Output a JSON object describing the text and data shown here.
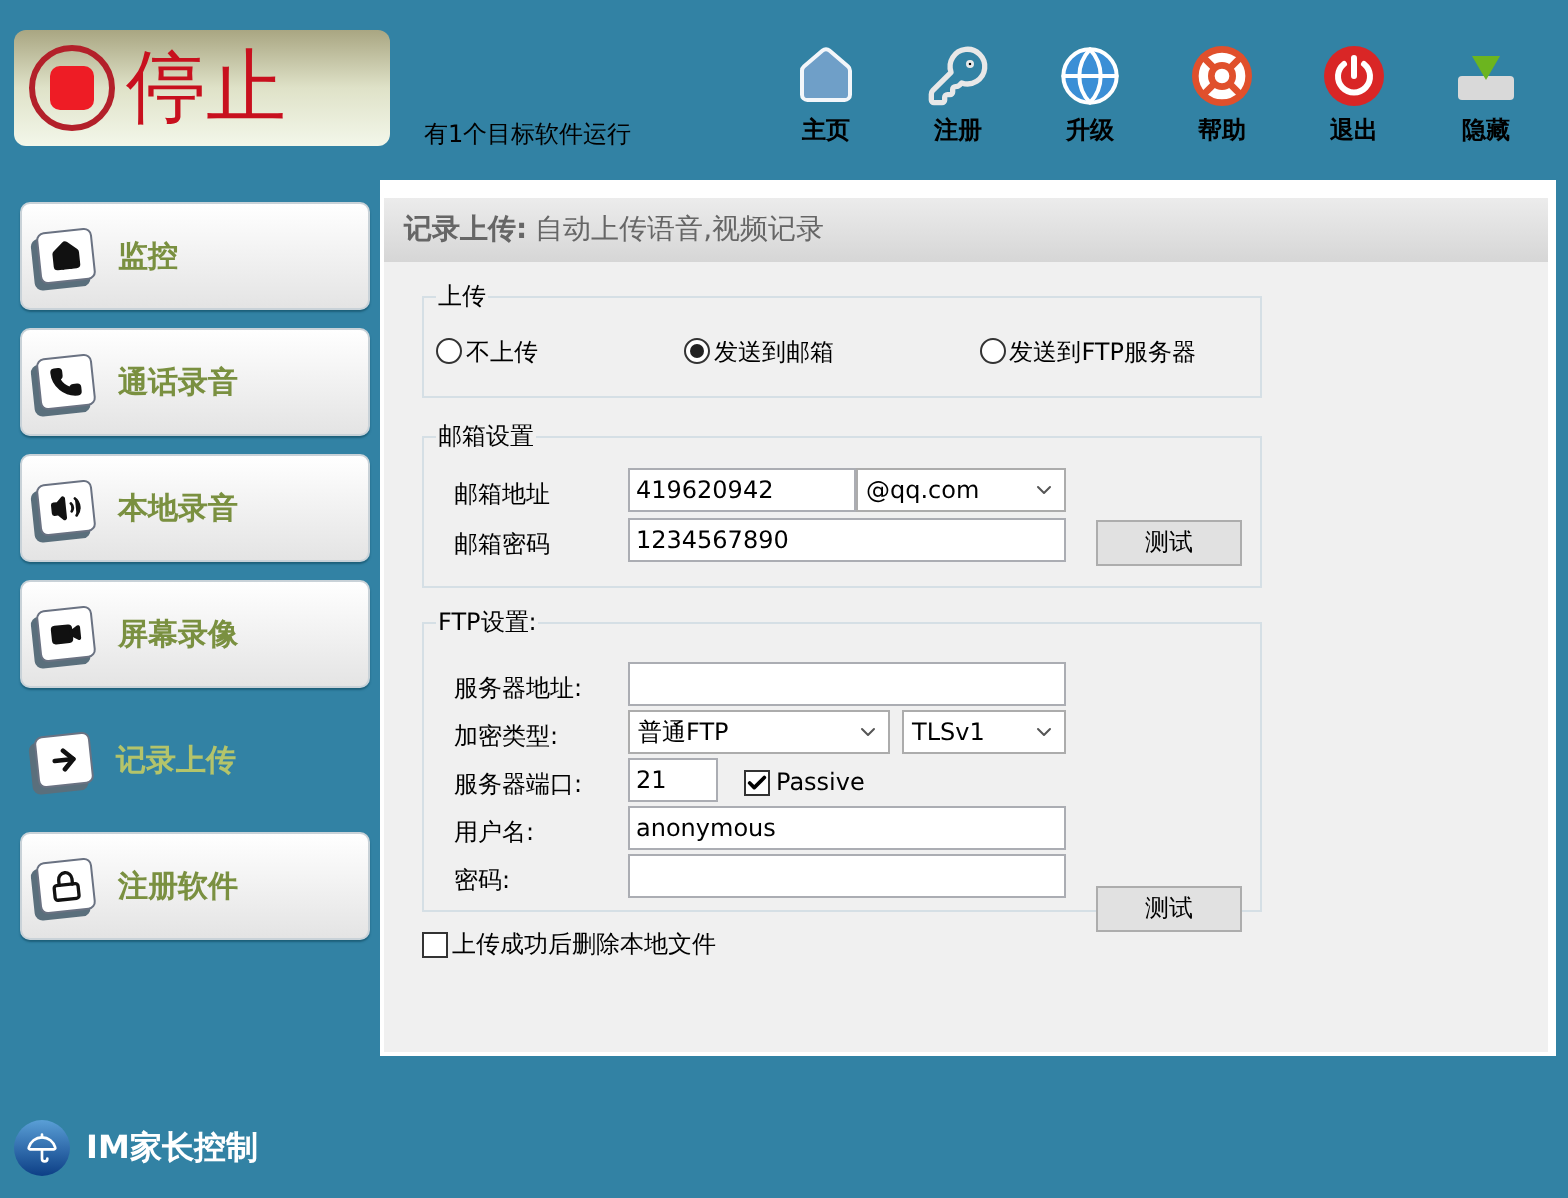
{
  "stop_button": {
    "label": "停止"
  },
  "status_text": "有1个目标软件运行",
  "toolbar": [
    {
      "label": "主页",
      "kind": "home"
    },
    {
      "label": "注册",
      "kind": "keys"
    },
    {
      "label": "升级",
      "kind": "globe"
    },
    {
      "label": "帮助",
      "kind": "lifebuoy"
    },
    {
      "label": "退出",
      "kind": "power"
    },
    {
      "label": "隐藏",
      "kind": "hide"
    }
  ],
  "sidebar": {
    "items": [
      {
        "label": "监控",
        "kind": "home",
        "selected": false
      },
      {
        "label": "通话录音",
        "kind": "phone",
        "selected": false
      },
      {
        "label": "本地录音",
        "kind": "speaker",
        "selected": false
      },
      {
        "label": "屏幕录像",
        "kind": "camera",
        "selected": false
      },
      {
        "label": "记录上传",
        "kind": "arrow",
        "selected": true
      },
      {
        "label": "注册软件",
        "kind": "lock",
        "selected": false
      }
    ]
  },
  "panel": {
    "title": "记录上传:",
    "subtitle": "自动上传语音,视频记录",
    "upload_group": {
      "legend": "上传",
      "options": [
        {
          "label": "不上传",
          "selected": false
        },
        {
          "label": "发送到邮箱",
          "selected": true
        },
        {
          "label": "发送到FTP服务器",
          "selected": false
        }
      ]
    },
    "email_group": {
      "legend": "邮箱设置",
      "address_label": "邮箱地址",
      "address_value": "419620942",
      "domain_value": "@qq.com",
      "password_label": "邮箱密码",
      "password_value": "1234567890",
      "test_button": "测试"
    },
    "ftp_group": {
      "legend": "FTP设置:",
      "server_label": "服务器地址:",
      "encryption_label": "加密类型:",
      "encryption_value": "普通FTP",
      "tls_value": "TLSv1",
      "port_label": "服务器端口:",
      "port_value": "21",
      "passive": {
        "label": "Passive",
        "checked": true
      },
      "user_label": "用户名:",
      "user_value": "anonymous",
      "password_label": "密码:",
      "test_button": "测试"
    },
    "delete_after_upload": {
      "label": "上传成功后删除本地文件",
      "checked": false
    }
  },
  "footer": {
    "brand": "IM家长控制"
  }
}
